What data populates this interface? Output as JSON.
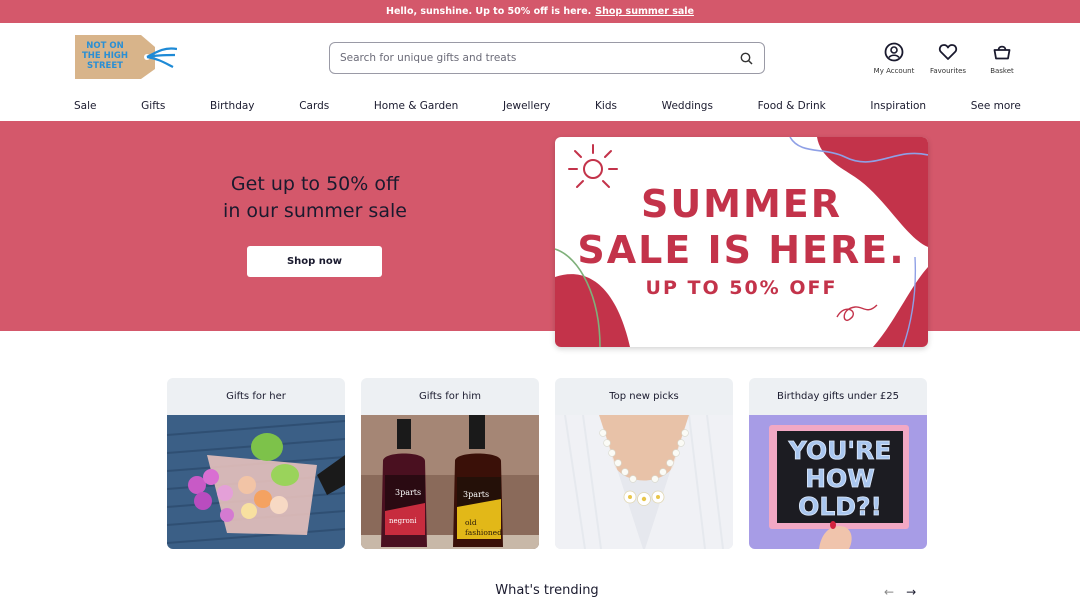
{
  "promo": {
    "text": "Hello, sunshine. Up to 50% off is here.",
    "link": "Shop summer sale"
  },
  "logo": {
    "lines": [
      "NOT ON",
      "THE HIGH",
      "STREET"
    ]
  },
  "search": {
    "placeholder": "Search for unique gifts and treats"
  },
  "header_actions": [
    {
      "label": "My Account",
      "icon": "account-icon"
    },
    {
      "label": "Favourites",
      "icon": "heart-icon"
    },
    {
      "label": "Basket",
      "icon": "basket-icon"
    }
  ],
  "nav": [
    "Sale",
    "Gifts",
    "Birthday",
    "Cards",
    "Home & Garden",
    "Jewellery",
    "Kids",
    "Weddings",
    "Food & Drink",
    "Inspiration",
    "See more"
  ],
  "hero": {
    "heading_line1": "Get up to 50% off",
    "heading_line2": "in our summer sale",
    "button": "Shop now",
    "banner_line1": "SUMMER",
    "banner_line2": "SALE IS HERE.",
    "banner_line3": "UP TO 50% OFF"
  },
  "tiles": [
    {
      "label": "Gifts for her"
    },
    {
      "label": "Gifts for him",
      "bottle1_brand": "3parts",
      "bottle1_name": "negroni",
      "bottle2_brand": "3parts",
      "bottle2_name1": "old",
      "bottle2_name2": "fashioned"
    },
    {
      "label": "Top new picks"
    },
    {
      "label": "Birthday gifts under £25",
      "card_line1": "YOU'RE",
      "card_line2": "HOW",
      "card_line3": "OLD?!"
    }
  ],
  "trending": {
    "title": "What's trending",
    "prev": "←",
    "next": "→"
  },
  "colors": {
    "brand_pink": "#d4586b",
    "sale_red": "#c3334a",
    "tile_bg": "#edf0f3"
  }
}
